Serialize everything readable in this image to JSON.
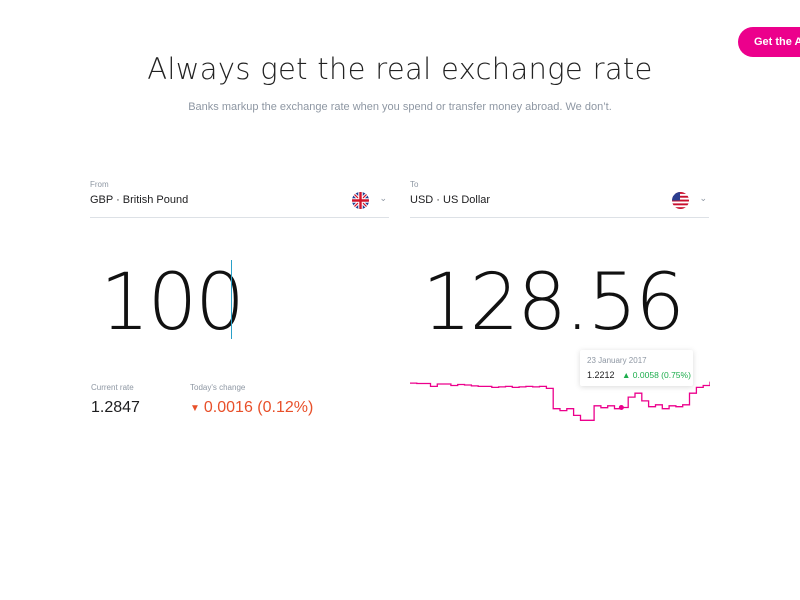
{
  "header": {
    "cta_label": "Get the App",
    "title": "Always get the real exchange rate",
    "subtitle": "Banks markup the exchange rate when you spend or transfer money abroad. We don’t."
  },
  "from": {
    "label": "From",
    "currency": "GBP · British Pound",
    "flag": "uk-flag-icon"
  },
  "to": {
    "label": "To",
    "currency": "USD · US Dollar",
    "flag": "us-flag-icon"
  },
  "amount": "100",
  "converted": "128.56",
  "current_rate": {
    "label": "Current rate",
    "value": "1.2847"
  },
  "todays_change": {
    "label": "Today's change",
    "value": "0.0016 (0.12%)",
    "direction": "down"
  },
  "tooltip": {
    "date": "23 January 2017",
    "value": "1.2212",
    "change": "0.0058 (0.75%)",
    "direction": "up"
  },
  "colors": {
    "accent": "#ec008c",
    "negative": "#e8502a",
    "positive": "#1cad4c",
    "caret": "#2aa0c8"
  },
  "chart_data": {
    "type": "line",
    "series": [
      {
        "values": [
          1.2465,
          1.246,
          1.246,
          1.243,
          1.2455,
          1.2455,
          1.244,
          1.245,
          1.2445,
          1.2435,
          1.243,
          1.243,
          1.242,
          1.2425,
          1.243,
          1.242,
          1.2425,
          1.243,
          1.2425,
          1.243,
          1.241,
          1.22,
          1.218,
          1.22,
          1.213,
          1.208,
          1.208,
          1.223,
          1.221,
          1.223,
          1.22,
          1.2212,
          1.232,
          1.236,
          1.228,
          1.222,
          1.224,
          1.22,
          1.223,
          1.222,
          1.224,
          1.236,
          1.242,
          1.244,
          1.248
        ]
      }
    ],
    "ylim": [
      1.2,
      1.26
    ],
    "highlight_index": 31,
    "grid": false
  }
}
